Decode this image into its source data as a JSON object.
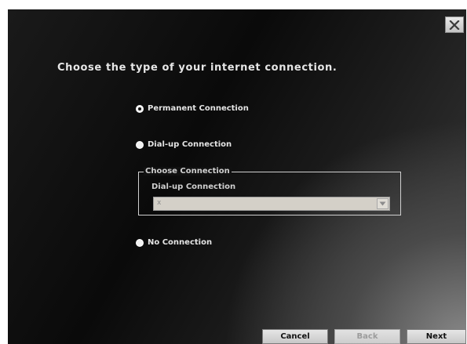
{
  "dialog": {
    "title": "Choose the type of your internet connection.",
    "close_icon": "close-x-icon"
  },
  "options": {
    "permanent": {
      "label": "Permanent Connection",
      "selected": true
    },
    "dialup": {
      "label": "Dial-up Connection",
      "selected": false
    },
    "none": {
      "label": "No Connection",
      "selected": false
    }
  },
  "choose_connection": {
    "legend": "Choose Connection",
    "label": "Dial-up Connection",
    "select_value": "x",
    "select_icon": "chevron-down-icon"
  },
  "buttons": {
    "cancel": "Cancel",
    "back": "Back",
    "next": "Next"
  }
}
